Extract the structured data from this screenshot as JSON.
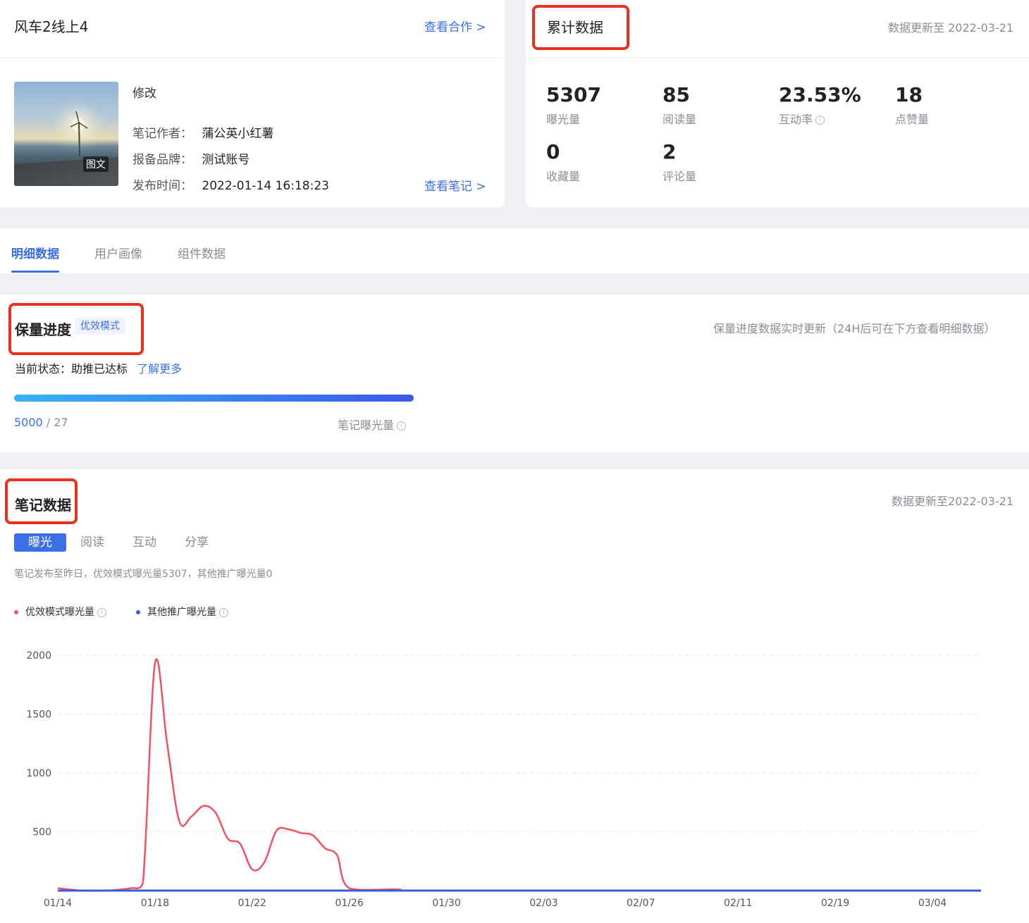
{
  "note": {
    "title": "风车2线上4",
    "view_coop_link": "查看合作 >",
    "edit_label": "修改",
    "cover_tag": "图文",
    "author_label": "笔记作者：",
    "author_value": "蒲公英小红薯",
    "brand_label": "报备品牌：",
    "brand_value": "测试账号",
    "publish_label": "发布时间：",
    "publish_value": "2022-01-14 16:18:23",
    "view_note_link": "查看笔记 >"
  },
  "cumulative": {
    "title": "累计数据",
    "updated": "数据更新至 2022-03-21",
    "stats": [
      {
        "value": "5307",
        "label": "曝光量"
      },
      {
        "value": "85",
        "label": "阅读量"
      },
      {
        "value": "23.53%",
        "label": "互动率"
      },
      {
        "value": "18",
        "label": "点赞量"
      },
      {
        "value": "0",
        "label": "收藏量"
      },
      {
        "value": "2",
        "label": "评论量"
      }
    ]
  },
  "tabs": [
    {
      "label": "明细数据",
      "active": true
    },
    {
      "label": "用户画像",
      "active": false
    },
    {
      "label": "组件数据",
      "active": false
    }
  ],
  "progress": {
    "title": "保量进度",
    "mode_badge": "优效模式",
    "note_right": "保量进度数据实时更新（24H后可在下方查看明细数据）",
    "status_label": "当前状态：",
    "status_value": "助推已达标",
    "learn_more": "了解更多",
    "target": "5000",
    "separator": " / ",
    "current": "27",
    "metric_label": "笔记曝光量",
    "fill_fraction": 1.0
  },
  "note_data": {
    "title": "笔记数据",
    "updated": "数据更新至2022-03-21",
    "subtabs": [
      {
        "label": "曝光",
        "active": true
      },
      {
        "label": "阅读",
        "active": false
      },
      {
        "label": "互动",
        "active": false
      },
      {
        "label": "分享",
        "active": false
      }
    ],
    "summary": "笔记发布至昨日，优效模式曝光量5307，其他推广曝光量0"
  },
  "colors": {
    "accent": "#3a6fe6",
    "highlight_box": "#e8321e",
    "series_red": "#f5515f",
    "series_blue": "#3a5be6"
  },
  "icons": {
    "info": "info-circle-icon"
  },
  "chart_data": {
    "type": "line",
    "title": "",
    "xlabel": "",
    "ylabel": "",
    "ylim": [
      0,
      2000
    ],
    "yticks": [
      "500",
      "1000",
      "1500",
      "2000"
    ],
    "xticks": [
      "01/14",
      "01/18",
      "01/22",
      "01/26",
      "01/30",
      "02/03",
      "02/07",
      "02/11",
      "02/19",
      "03/04"
    ],
    "grid": true,
    "legend_position": "top-left",
    "series": [
      {
        "name": "优效模式曝光量",
        "color": "#f5515f",
        "points": [
          [
            "01/14",
            20
          ],
          [
            "01/15",
            0
          ],
          [
            "01/16",
            0
          ],
          [
            "01/17",
            20
          ],
          [
            "01/17.5",
            60
          ],
          [
            "01/18",
            1930
          ],
          [
            "01/18.5",
            1250
          ],
          [
            "01/19",
            590
          ],
          [
            "01/19.5",
            630
          ],
          [
            "01/20",
            720
          ],
          [
            "01/20.5",
            660
          ],
          [
            "01/21",
            440
          ],
          [
            "01/21.5",
            400
          ],
          [
            "01/22",
            180
          ],
          [
            "01/22.5",
            240
          ],
          [
            "01/23",
            510
          ],
          [
            "01/23.5",
            520
          ],
          [
            "01/24",
            490
          ],
          [
            "01/24.5",
            470
          ],
          [
            "01/25",
            360
          ],
          [
            "01/25.5",
            300
          ],
          [
            "01/26",
            20
          ],
          [
            "01/28",
            10
          ],
          [
            "01/30",
            0
          ],
          [
            "03/04",
            0
          ]
        ]
      },
      {
        "name": "其他推广曝光量",
        "color": "#3a5be6",
        "points": [
          [
            "01/14",
            0
          ],
          [
            "03/04",
            0
          ]
        ]
      }
    ]
  }
}
